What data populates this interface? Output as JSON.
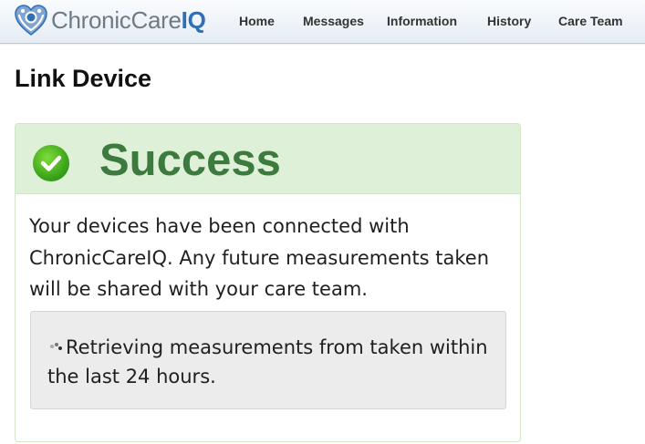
{
  "brand": {
    "name_part1": "ChronicCare",
    "name_part2": "IQ",
    "accent": "#2f6fb6"
  },
  "nav": {
    "items": [
      "Home",
      "Messages",
      "Information",
      "History",
      "Care Team"
    ]
  },
  "page": {
    "title": "Link Device"
  },
  "status": {
    "heading": "Success",
    "icon": "check-circle-icon",
    "color": "#3c7a3e",
    "background": "#dff0d8",
    "message": "Your devices have been connected with ChronicCareIQ. Any future measurements taken will be shared with your care team."
  },
  "progress": {
    "icon": "spinner-icon",
    "message": "Retrieving measurements from taken within the last 24 hours."
  }
}
